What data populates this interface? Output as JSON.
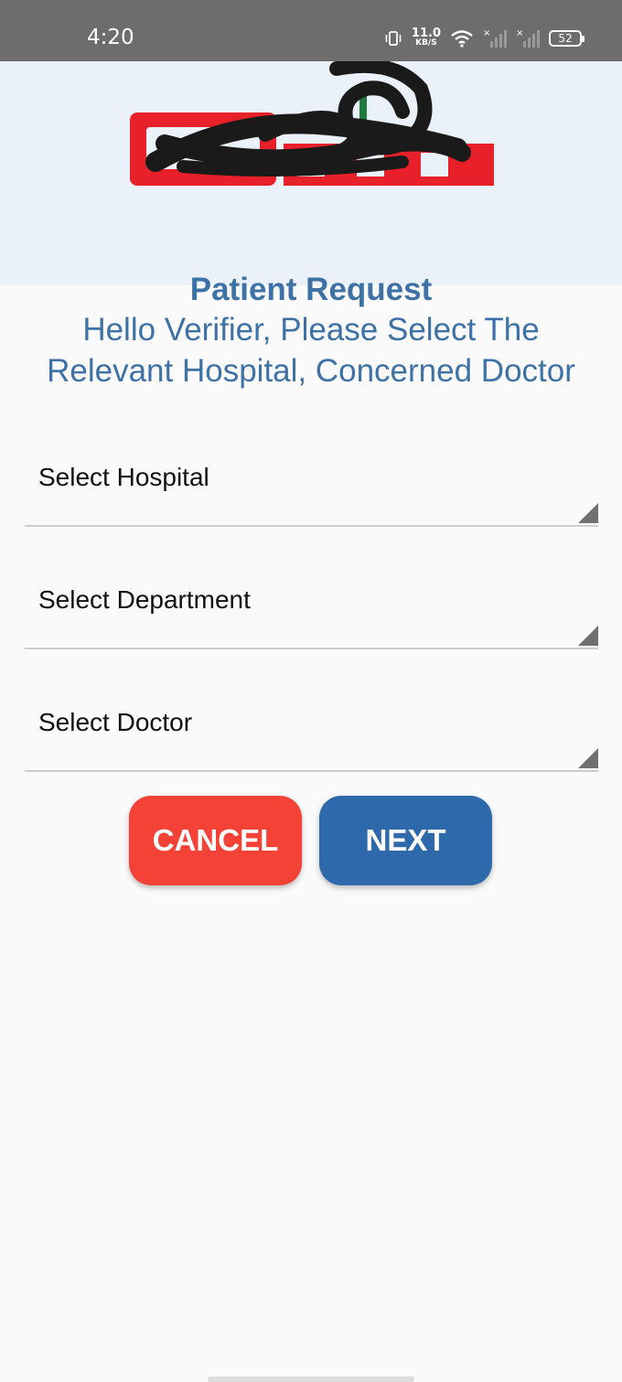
{
  "status_bar": {
    "time": "4:20",
    "net_speed_value": "11.0",
    "net_speed_unit": "KB/S",
    "battery": "52",
    "icons": [
      "vibrate-icon",
      "wifi-icon",
      "signal-icon",
      "signal-icon"
    ]
  },
  "header": {
    "title": "Patient Request",
    "logo_colors": {
      "brand_red": "#e8202a",
      "scribble": "#1a1a1a",
      "accent_green": "#1e7a3a"
    }
  },
  "prompt": {
    "line1": "Hello Verifier, Please Select The",
    "line2": "Relevant Hospital, Concerned Doctor"
  },
  "form": {
    "hospital_placeholder": "Select Hospital",
    "department_placeholder": "Select Department",
    "doctor_placeholder": "Select Doctor"
  },
  "buttons": {
    "cancel": "CANCEL",
    "next": "NEXT"
  },
  "colors": {
    "header_bg": "#ebf1f9",
    "title_blue": "#3e72a6",
    "cancel_red": "#f44336",
    "next_blue": "#2e6aab"
  }
}
